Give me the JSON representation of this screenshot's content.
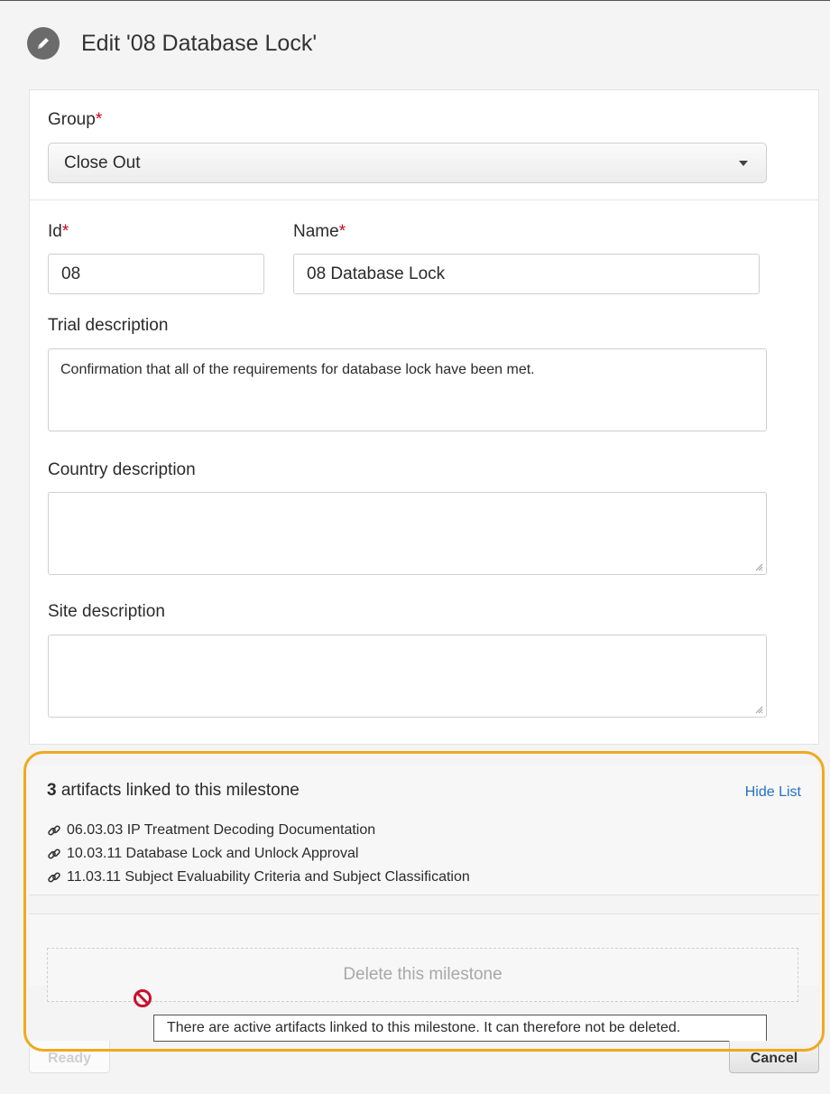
{
  "page": {
    "title": "Edit '08 Database Lock'",
    "icon": "pencil-icon"
  },
  "form": {
    "group": {
      "label": "Group",
      "required_mark": "*",
      "value": "Close Out"
    },
    "id": {
      "label": "Id",
      "required_mark": "*",
      "value": "08"
    },
    "name": {
      "label": "Name",
      "required_mark": "*",
      "value": "08 Database Lock"
    },
    "trial_description": {
      "label": "Trial description",
      "value": "Confirmation that all of the requirements for database lock have been met."
    },
    "country_description": {
      "label": "Country description",
      "value": ""
    },
    "site_description": {
      "label": "Site description",
      "value": ""
    }
  },
  "artifacts": {
    "count": "3",
    "heading_suffix": "artifacts linked to this milestone",
    "toggle_label": "Hide List",
    "items": [
      "06.03.03 IP Treatment Decoding Documentation",
      "10.03.11 Database Lock and Unlock Approval",
      "11.03.11 Subject Evaluability Criteria and Subject Classification"
    ],
    "item_icon": "link-icon"
  },
  "delete": {
    "label": "Delete this milestone",
    "disabled_icon": "no-entry-icon",
    "tooltip": "There are active artifacts linked to this milestone. It can therefore not be deleted."
  },
  "footer": {
    "ready_label": "Ready",
    "cancel_label": "Cancel"
  },
  "colors": {
    "highlight": "#f0a91e",
    "required": "#d0021b",
    "link": "#2470c7",
    "disabled_icon": "#c8102e"
  }
}
